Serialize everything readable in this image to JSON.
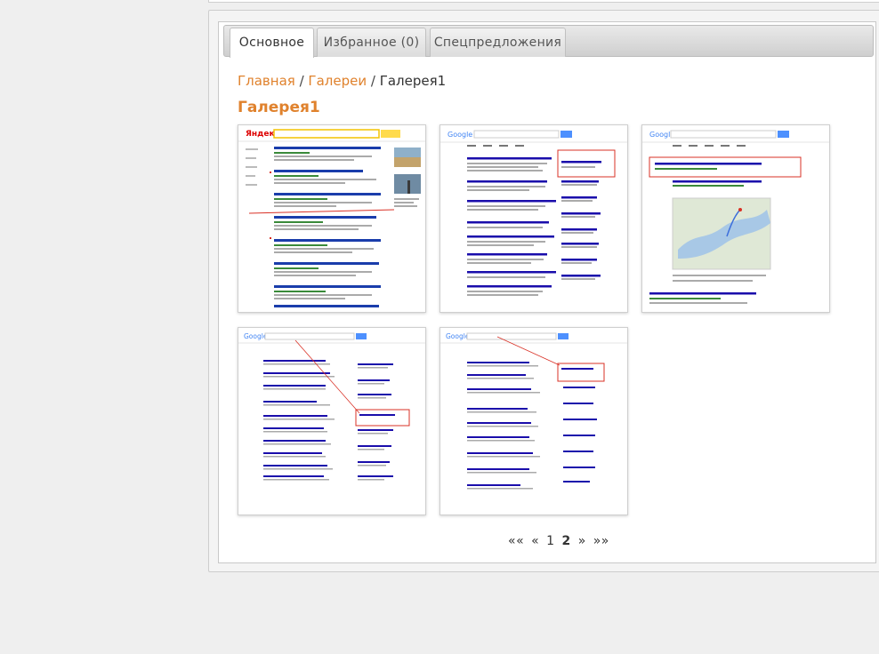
{
  "tabs": [
    {
      "label": "Основное"
    },
    {
      "label": "Избранное (0)"
    },
    {
      "label": "Спецпредложения"
    }
  ],
  "breadcrumb": {
    "home": "Главная",
    "sep1": "/",
    "galleries": "Галереи",
    "sep2": "/",
    "current": "Галерея1"
  },
  "title": "Галерея1",
  "thumbnails": [
    {
      "name": "yandex-search-screenshot",
      "logo": "Яндекс"
    },
    {
      "name": "google-search-screenshot-1",
      "logo": "Google"
    },
    {
      "name": "google-search-screenshot-2",
      "logo": "Google"
    },
    {
      "name": "google-search-screenshot-3",
      "logo": "Google"
    },
    {
      "name": "google-search-screenshot-4",
      "logo": "Google"
    }
  ],
  "pagination": {
    "first": "««",
    "prev": "«",
    "page1": "1",
    "page2": "2",
    "next": "»",
    "last": "»»"
  },
  "colors": {
    "accent": "#e0822d",
    "link": "#1a0dab",
    "highlight": "#d93025"
  }
}
